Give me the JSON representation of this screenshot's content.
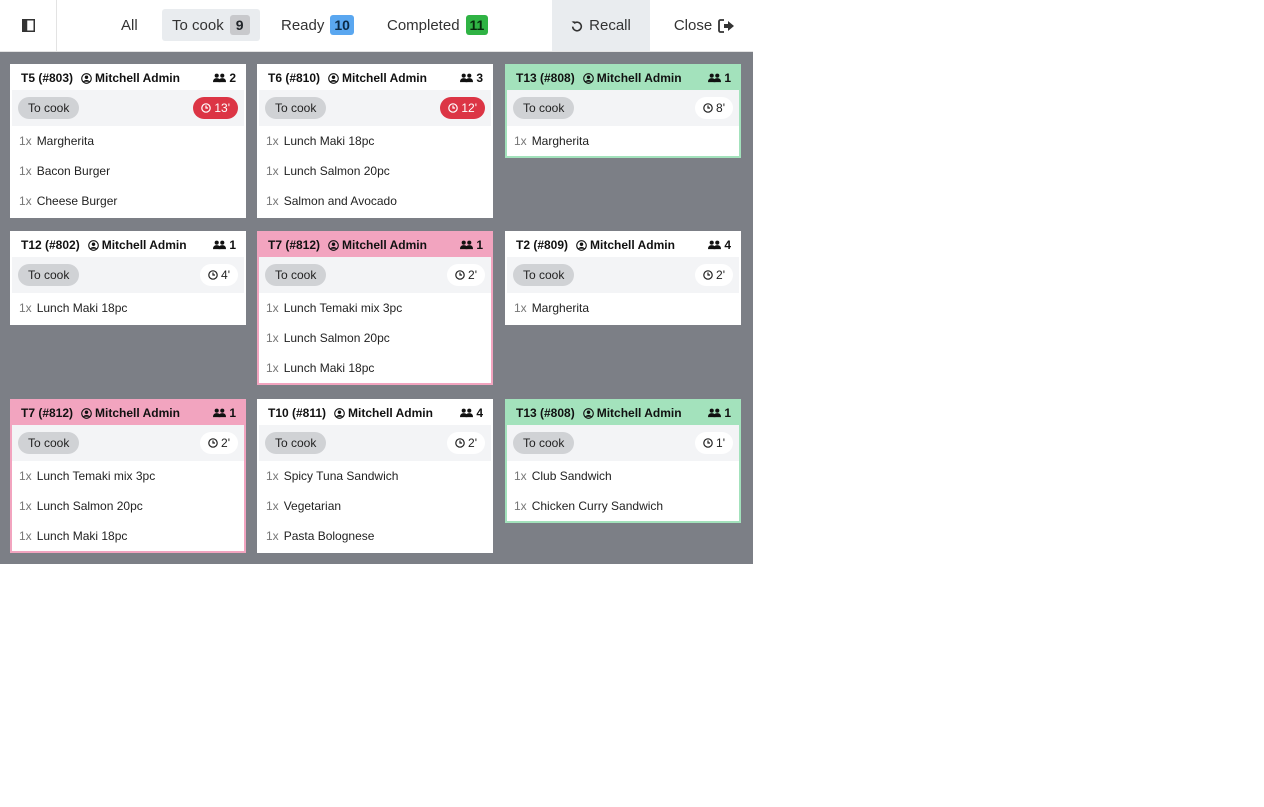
{
  "topbar": {
    "filters": [
      {
        "label": "All",
        "count": ""
      },
      {
        "label": "To cook",
        "count": "9"
      },
      {
        "label": "Ready",
        "count": "10"
      },
      {
        "label": "Completed",
        "count": "11"
      }
    ],
    "recall_label": "Recall",
    "close_label": "Close"
  },
  "colors": {
    "board_bg": "#7c7f86",
    "late_timer": "#dc3545",
    "pink_card": "#f2a4bf",
    "green_card": "#a3e2bc",
    "ready_badge": "#5aa7f0",
    "completed_badge": "#2fb344"
  },
  "orders": [
    {
      "table": "T5 (#803)",
      "user": "Mitchell Admin",
      "guests": "2",
      "status": "To cook",
      "timer": "13'",
      "lines": [
        {
          "qty": "1x",
          "name": "Margherita"
        },
        {
          "qty": "1x",
          "name": "Bacon Burger"
        },
        {
          "qty": "1x",
          "name": "Cheese Burger"
        }
      ]
    },
    {
      "table": "T6 (#810)",
      "user": "Mitchell Admin",
      "guests": "3",
      "status": "To cook",
      "timer": "12'",
      "lines": [
        {
          "qty": "1x",
          "name": "Lunch Maki 18pc"
        },
        {
          "qty": "1x",
          "name": "Lunch Salmon 20pc"
        },
        {
          "qty": "1x",
          "name": "Salmon and Avocado"
        }
      ]
    },
    {
      "table": "T13 (#808)",
      "user": "Mitchell Admin",
      "guests": "1",
      "status": "To cook",
      "timer": "8'",
      "lines": [
        {
          "qty": "1x",
          "name": "Margherita"
        }
      ]
    },
    {
      "table": "T12 (#802)",
      "user": "Mitchell Admin",
      "guests": "1",
      "status": "To cook",
      "timer": "4'",
      "lines": [
        {
          "qty": "1x",
          "name": "Lunch Maki 18pc"
        }
      ]
    },
    {
      "table": "T7 (#812)",
      "user": "Mitchell Admin",
      "guests": "1",
      "status": "To cook",
      "timer": "2'",
      "lines": [
        {
          "qty": "1x",
          "name": "Lunch Temaki mix 3pc"
        },
        {
          "qty": "1x",
          "name": "Lunch Salmon 20pc"
        },
        {
          "qty": "1x",
          "name": "Lunch Maki 18pc"
        }
      ]
    },
    {
      "table": "T2 (#809)",
      "user": "Mitchell Admin",
      "guests": "4",
      "status": "To cook",
      "timer": "2'",
      "lines": [
        {
          "qty": "1x",
          "name": "Margherita"
        }
      ]
    },
    {
      "table": "T7 (#812)",
      "user": "Mitchell Admin",
      "guests": "1",
      "status": "To cook",
      "timer": "2'",
      "lines": [
        {
          "qty": "1x",
          "name": "Lunch Temaki mix 3pc"
        },
        {
          "qty": "1x",
          "name": "Lunch Salmon 20pc"
        },
        {
          "qty": "1x",
          "name": "Lunch Maki 18pc"
        }
      ]
    },
    {
      "table": "T10 (#811)",
      "user": "Mitchell Admin",
      "guests": "4",
      "status": "To cook",
      "timer": "2'",
      "lines": [
        {
          "qty": "1x",
          "name": "Spicy Tuna Sandwich"
        },
        {
          "qty": "1x",
          "name": "Vegetarian"
        },
        {
          "qty": "1x",
          "name": "Pasta Bolognese"
        }
      ]
    },
    {
      "table": "T13 (#808)",
      "user": "Mitchell Admin",
      "guests": "1",
      "status": "To cook",
      "timer": "1'",
      "lines": [
        {
          "qty": "1x",
          "name": "Club Sandwich"
        },
        {
          "qty": "1x",
          "name": "Chicken Curry Sandwich"
        }
      ]
    }
  ],
  "icons": {
    "sidebar": "sidebar-toggle-icon",
    "recall": "undo-icon",
    "close": "sign-out-icon",
    "user": "user-circle-icon",
    "guests": "users-icon",
    "timer": "clock-icon"
  }
}
